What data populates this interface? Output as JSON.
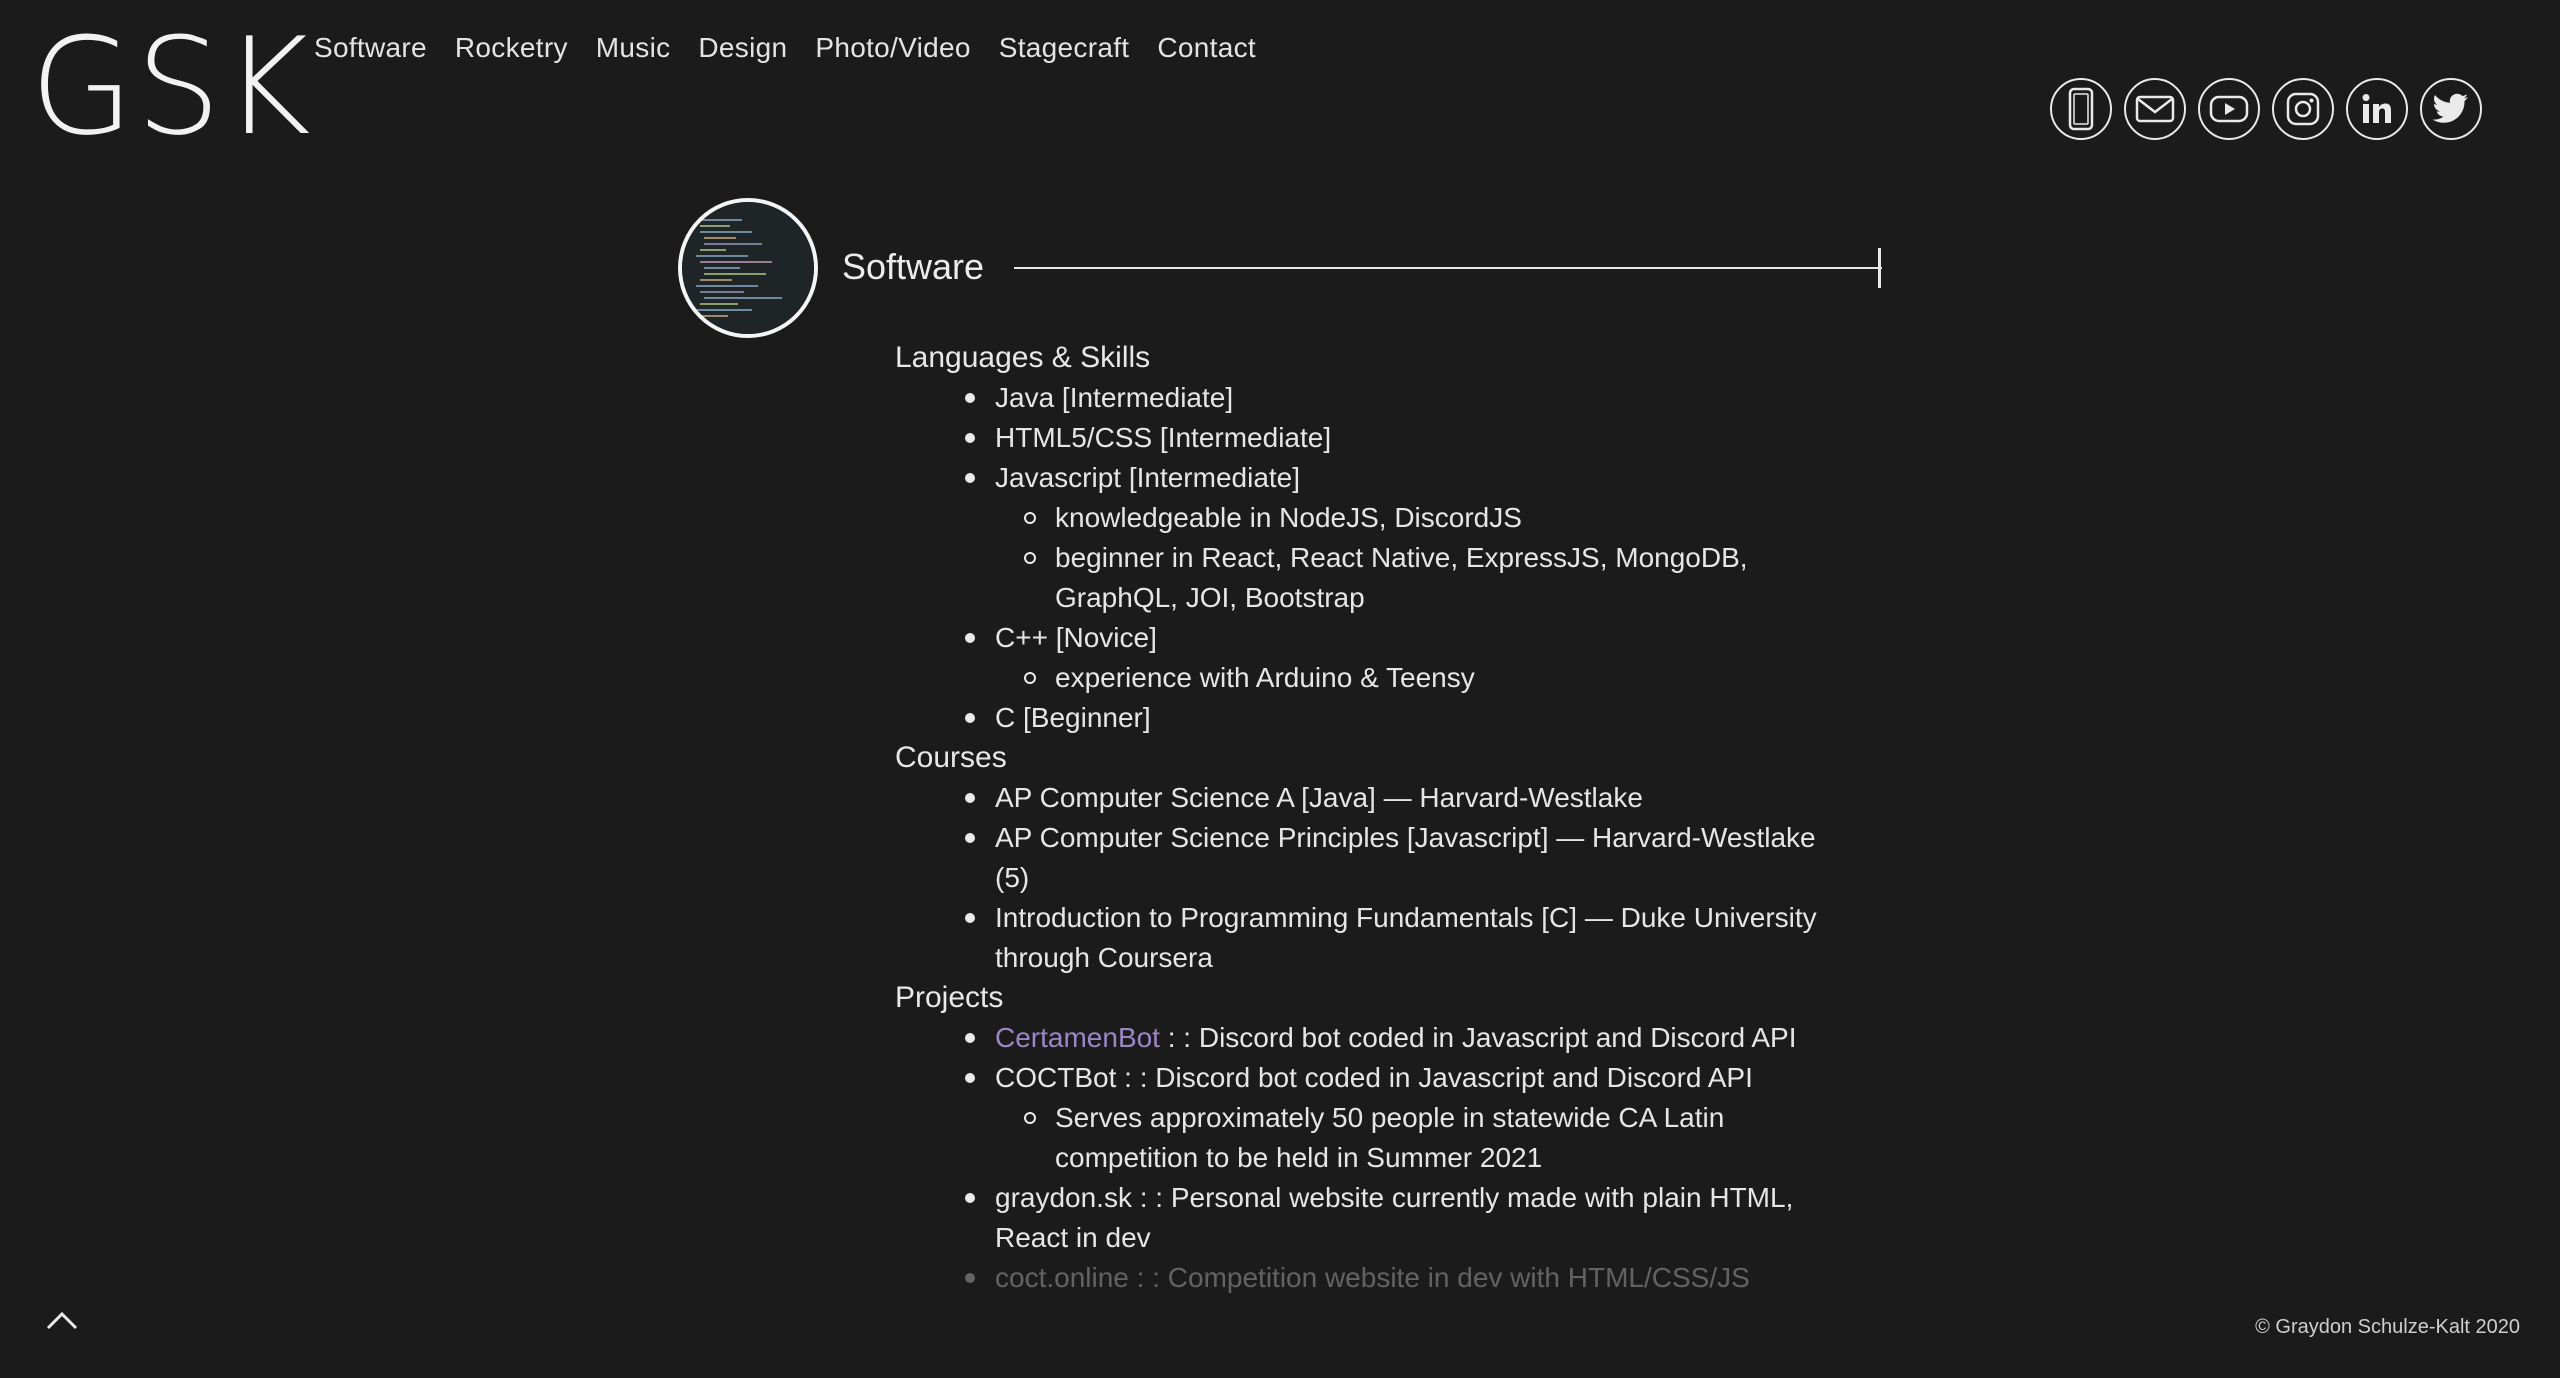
{
  "logo": "GSK",
  "nav": [
    "Software",
    "Rocketry",
    "Music",
    "Design",
    "Photo/Video",
    "Stagecraft",
    "Contact"
  ],
  "socials": [
    "phone-icon",
    "mail-icon",
    "youtube-icon",
    "instagram-icon",
    "linkedin-icon",
    "twitter-icon"
  ],
  "section": {
    "title": "Software"
  },
  "languages": {
    "heading": "Languages & Skills",
    "items": [
      {
        "text": "Java [Intermediate]"
      },
      {
        "text": "HTML5/CSS [Intermediate]"
      },
      {
        "text": "Javascript [Intermediate]",
        "sub": [
          "knowledgeable in NodeJS, DiscordJS",
          "beginner in React, React Native, ExpressJS, MongoDB, GraphQL, JOI, Bootstrap"
        ]
      },
      {
        "text": "C++ [Novice]",
        "sub": [
          "experience with Arduino & Teensy"
        ]
      },
      {
        "text": "C [Beginner]"
      }
    ]
  },
  "courses": {
    "heading": "Courses",
    "items": [
      "AP Computer Science A [Java] — Harvard-Westlake",
      "AP Computer Science Principles [Javascript] — Harvard-Westlake (5)",
      "Introduction to Programming Fundamentals [C] — Duke University through Coursera"
    ]
  },
  "projects": {
    "heading": "Projects",
    "certamen_link": "CertamenBot",
    "certamen_rest": " : : Discord bot coded in Javascript and Discord API",
    "coct": "COCTBot : : Discord bot coded in Javascript and Discord API",
    "coct_sub": "Serves approximately 50 people in statewide CA Latin competition to be held in Summer 2021",
    "graydon": "graydon.sk : : Personal website currently made with plain HTML, React in dev",
    "coct_online_link": "coct.online",
    "coct_online_rest": " : : Competition website in dev with HTML/CSS/JS"
  },
  "footer": "© Graydon Schulze-Kalt 2020",
  "colors": {
    "background": "#1b1b1b",
    "text": "#e6e6e6",
    "link": "#9b86c7"
  }
}
